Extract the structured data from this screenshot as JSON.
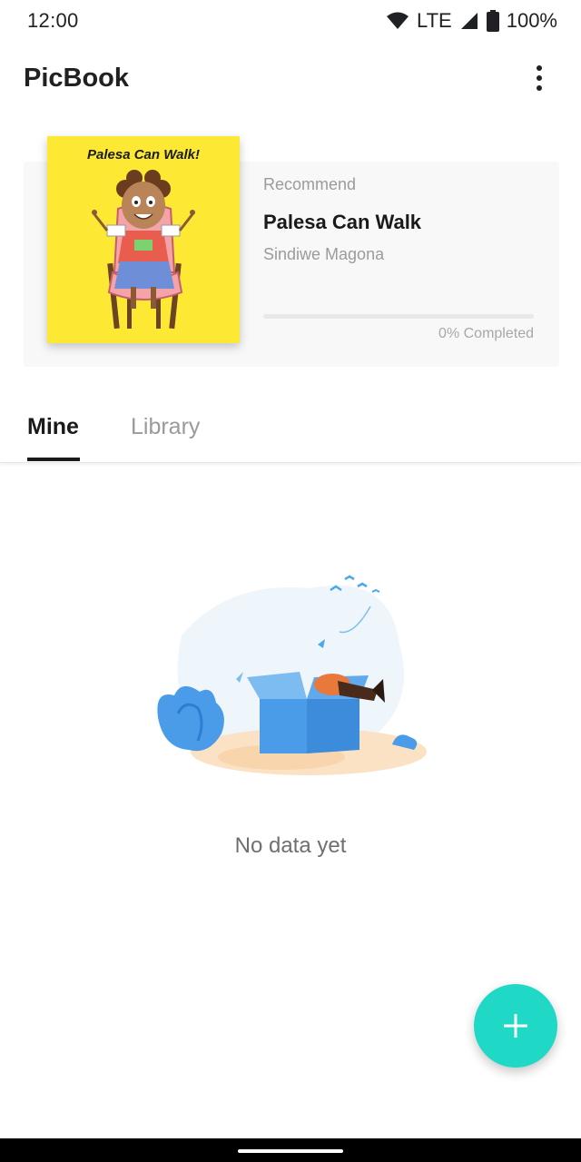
{
  "status_bar": {
    "time": "12:00",
    "network": "LTE",
    "battery": "100%",
    "icons": [
      "wifi-icon",
      "cellular-signal-icon",
      "battery-icon"
    ]
  },
  "app_bar": {
    "title": "PicBook",
    "menu_icon": "more-vert-icon"
  },
  "recommend": {
    "label": "Recommend",
    "book_title": "Palesa Can Walk",
    "author": "Sindiwe Magona",
    "progress": 0,
    "progress_text": "0% Completed",
    "cover": {
      "title": "Palesa Can Walk!",
      "background": "#fde933"
    }
  },
  "tabs": [
    {
      "label": "Mine",
      "active": true
    },
    {
      "label": "Library",
      "active": false
    }
  ],
  "empty_state": {
    "text": "No data yet",
    "icon": "empty-box-illustration"
  },
  "fab": {
    "icon": "plus-icon",
    "color": "#20d8c6"
  },
  "colors": {
    "accent": "#20d8c6",
    "text_primary": "#1a1a1a",
    "text_secondary": "#9b9b9b"
  }
}
